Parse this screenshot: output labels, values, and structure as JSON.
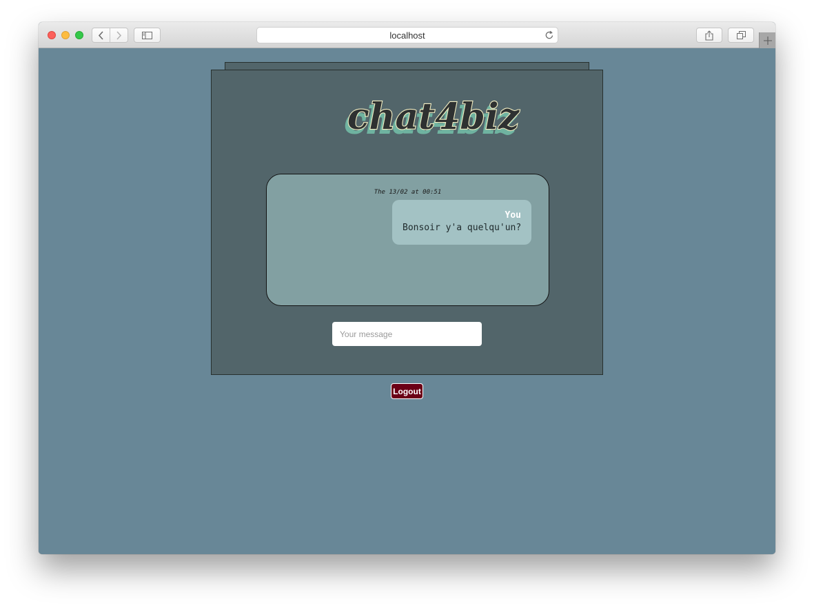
{
  "browser": {
    "url": "localhost",
    "icons": {
      "back": "chevron-left-icon",
      "forward": "chevron-right-icon",
      "sidebar": "sidebar-icon",
      "reload": "reload-icon",
      "share": "share-icon",
      "tabs": "tabs-overview-icon",
      "new_tab": "plus-icon"
    }
  },
  "app": {
    "logo_text": "chat4biz",
    "colors": {
      "page_background": "#688797",
      "panel": "#52656a",
      "chat_area": "#82a0a2",
      "bubble": "#a3c2c4",
      "logout_button": "#6b0016",
      "logo_fill": "#2e3131",
      "logo_outline": "#f3efc4",
      "logo_shadow": "#6fb3a0"
    }
  },
  "chat": {
    "messages": [
      {
        "timestamp": "The 13/02 at 00:51",
        "sender": "You",
        "text": "Bonsoir y'a quelqu'un?"
      }
    ]
  },
  "composer": {
    "placeholder": "Your message"
  },
  "actions": {
    "logout_label": "Logout"
  }
}
